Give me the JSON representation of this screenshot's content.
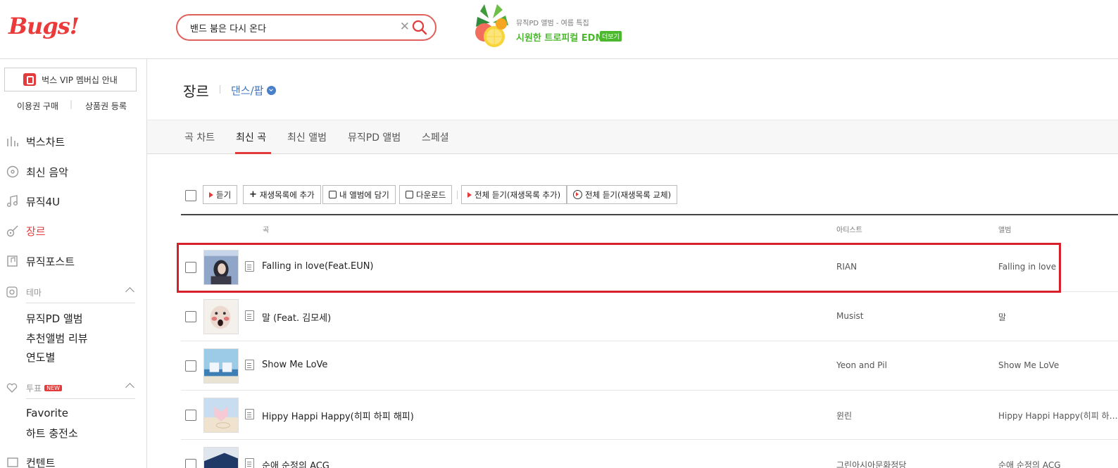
{
  "header": {
    "logo": "Bugs!",
    "search_value": "밴드 붐은 다시 온다",
    "promo_sub": "뮤직PD 앨범 - 여름 특집",
    "promo_title": "시원한 트로피컬 EDM",
    "promo_more": "더보기"
  },
  "sidebar": {
    "vip_label": "벅스 VIP 멤버십 안내",
    "buy_ticket": "이용권 구매",
    "register_voucher": "상품권 등록",
    "nav": [
      {
        "label": "벅스차트",
        "icon": "chart-icon"
      },
      {
        "label": "최신 음악",
        "icon": "disc-icon"
      },
      {
        "label": "뮤직4U",
        "icon": "music-note-icon"
      },
      {
        "label": "장르",
        "icon": "guitar-icon"
      },
      {
        "label": "뮤직포스트",
        "icon": "post-icon"
      }
    ],
    "theme_head": "테마",
    "theme_items": [
      "뮤직PD 앨범",
      "추천앨범 리뷰",
      "연도별"
    ],
    "vote_head": "투표",
    "vote_badge": "NEW",
    "vote_items": [
      "Favorite",
      "하트 충전소"
    ],
    "partial_item": "컨텐트"
  },
  "main": {
    "page_title": "장르",
    "genre": "댄스/팝",
    "tabs": [
      "곡 차트",
      "최신 곡",
      "최신 앨범",
      "뮤직PD 앨범",
      "스페셜"
    ],
    "active_tab": "최신 곡",
    "toolbar": {
      "listen": "듣기",
      "add_playlist": "재생목록에 추가",
      "add_album": "내 앨범에 담기",
      "download": "다운로드",
      "listen_all_add": "전체 듣기(재생목록 추가)",
      "listen_all_replace": "전체 듣기(재생목록 교체)"
    },
    "columns": {
      "song": "곡",
      "artist": "아티스트",
      "album": "앨범"
    },
    "rows": [
      {
        "title": "Falling in love(Feat.EUN)",
        "artist": "RIAN",
        "album": "Falling in love"
      },
      {
        "title": "말 (Feat. 김모세)",
        "artist": "Musist",
        "album": "말"
      },
      {
        "title": "Show Me LoVe",
        "artist": "Yeon and Pil",
        "album": "Show Me LoVe"
      },
      {
        "title": "Hippy Happi Happy(히피 하피 해피)",
        "artist": "윈린",
        "album": "Hippy Happi Happy(히피 하피 해피)"
      },
      {
        "title": "순애 순정의 ACG",
        "artist": "그린아시아문화정당",
        "album": "순애 순정의 ACG"
      }
    ]
  },
  "colors": {
    "brand": "#ea3a3a",
    "promo_green": "#4bb82e",
    "genre_blue": "#3f75c0",
    "highlight": "#d91f2a"
  }
}
